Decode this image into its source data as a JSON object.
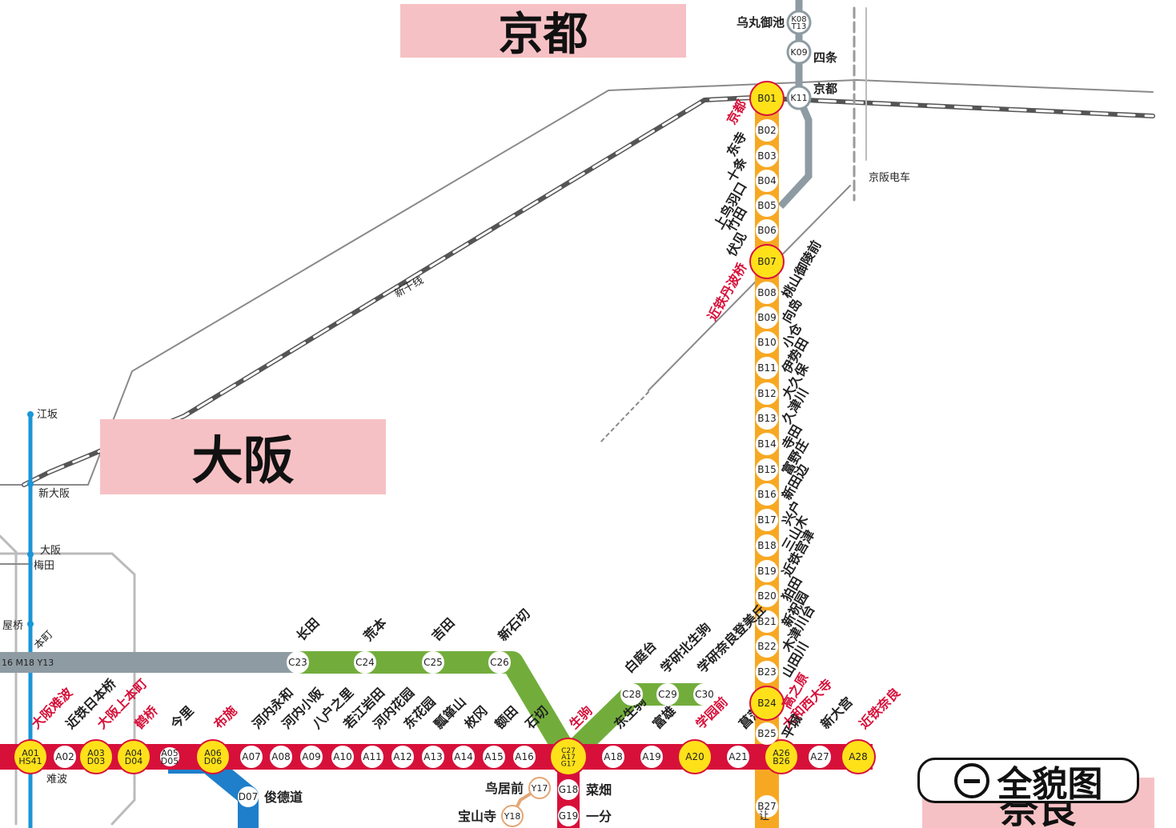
{
  "cities": {
    "kyoto": "京都",
    "osaka": "大阪",
    "nara": "奈良"
  },
  "overview_button": {
    "label": "全貌图",
    "icon": "zoom-out-icon"
  },
  "colors": {
    "line_a": "#d7103a",
    "line_b": "#f7a823",
    "line_c": "#72ad3c",
    "line_k": "#8e9ba3",
    "line_d": "#1f7fca",
    "line_y": "#e3a674",
    "transfer": "#ffe11a",
    "jr": "#555555",
    "region_box": "#f6c1c5"
  },
  "lines": {
    "A": {
      "stations": [
        {
          "code": "A01\nHS41",
          "name": "大阪难波",
          "transfer": true,
          "red": true
        },
        {
          "code": "A02",
          "name": "近铁日本桥"
        },
        {
          "code": "A03\nD03",
          "name": "大阪上本町",
          "transfer": true,
          "red": true
        },
        {
          "code": "A04\nD04",
          "name": "鹤桥",
          "transfer": true,
          "red": true
        },
        {
          "code": "A05\nD05",
          "name": "今里",
          "small": true
        },
        {
          "code": "A06\nD06",
          "name": "布施",
          "transfer": true,
          "red": true
        },
        {
          "code": "A07",
          "name": "河内永和"
        },
        {
          "code": "A08",
          "name": "河内小阪"
        },
        {
          "code": "A09",
          "name": "八户之里"
        },
        {
          "code": "A10",
          "name": "若江岩田"
        },
        {
          "code": "A11",
          "name": "河内花园"
        },
        {
          "code": "A12",
          "name": "东花园"
        },
        {
          "code": "A13",
          "name": "瓢箪山"
        },
        {
          "code": "A14",
          "name": "枚冈"
        },
        {
          "code": "A15",
          "name": "额田"
        },
        {
          "code": "A16",
          "name": "石切"
        },
        {
          "code": "C27\nA17\nG17",
          "name": "生驹",
          "transfer": true,
          "red": true
        },
        {
          "code": "A18",
          "name": "东生驹"
        },
        {
          "code": "A19",
          "name": "富雄"
        },
        {
          "code": "A20",
          "name": "学园前",
          "transfer": true,
          "red": true
        },
        {
          "code": "A21",
          "name": "菖蒲池"
        },
        {
          "code": "A26\nB26",
          "name": "大和西大寺",
          "transfer": true,
          "red": true
        },
        {
          "code": "A27",
          "name": "新大宫"
        },
        {
          "code": "A28",
          "name": "近铁奈良",
          "transfer": true,
          "red": true
        }
      ]
    },
    "B": {
      "stations": [
        {
          "code": "B01",
          "name": "京都",
          "transfer": true,
          "red": true
        },
        {
          "code": "B02",
          "name": "东寺"
        },
        {
          "code": "B03",
          "name": "十条"
        },
        {
          "code": "B04",
          "name": "上鸟羽口"
        },
        {
          "code": "B05",
          "name": "竹田"
        },
        {
          "code": "B06",
          "name": "伏见"
        },
        {
          "code": "B07",
          "name": "近铁丹波桥",
          "transfer": true,
          "red": true
        },
        {
          "code": "B08",
          "name": "桃山御陵前"
        },
        {
          "code": "B09",
          "name": "向岛"
        },
        {
          "code": "B10",
          "name": "小仓"
        },
        {
          "code": "B11",
          "name": "伊势田"
        },
        {
          "code": "B12",
          "name": "大久保"
        },
        {
          "code": "B13",
          "name": "久津川"
        },
        {
          "code": "B14",
          "name": "寺田"
        },
        {
          "code": "B15",
          "name": "富野庄"
        },
        {
          "code": "B16",
          "name": "新田边"
        },
        {
          "code": "B17",
          "name": "兴户"
        },
        {
          "code": "B18",
          "name": "三山木"
        },
        {
          "code": "B19",
          "name": "近铁宫津"
        },
        {
          "code": "B20",
          "name": "狛田"
        },
        {
          "code": "B21",
          "name": "新祝园"
        },
        {
          "code": "B22",
          "name": "木津川台"
        },
        {
          "code": "B23",
          "name": "山田川"
        },
        {
          "code": "B24",
          "name": "高之原",
          "transfer": true,
          "red": true
        },
        {
          "code": "B25",
          "name": "平城"
        },
        {
          "code": "B27",
          "name": ""
        }
      ]
    },
    "C": {
      "stations": [
        {
          "code": "C23",
          "name": "长田"
        },
        {
          "code": "C24",
          "name": "荒本"
        },
        {
          "code": "C25",
          "name": "吉田"
        },
        {
          "code": "C26",
          "name": "新石切"
        }
      ],
      "branch": [
        {
          "code": "C28",
          "name": "白庭台"
        },
        {
          "code": "C29",
          "name": "学研北生驹"
        },
        {
          "code": "C30",
          "name": "学研奈良登美丘"
        }
      ],
      "through_codes": "16 M18 Y13"
    },
    "K": {
      "stations": [
        {
          "code": "K08\nT13",
          "name": "乌丸御池"
        },
        {
          "code": "K09",
          "name": "四条"
        },
        {
          "code": "K11",
          "name": "京都"
        }
      ]
    },
    "G": {
      "stations": [
        {
          "code": "G18",
          "name": "菜畑"
        },
        {
          "code": "G19",
          "name": "一分"
        }
      ]
    },
    "Y": {
      "stations": [
        {
          "code": "Y17",
          "name": "鸟居前"
        },
        {
          "code": "Y18",
          "name": "宝山寺"
        }
      ]
    },
    "D": {
      "stations": [
        {
          "code": "D07",
          "name": "俊德道"
        }
      ]
    }
  },
  "other_labels": {
    "shinkansen": "新干线",
    "keihan": "京阪电车",
    "esaka": "江坂",
    "shin_osaka": "新大阪",
    "osaka_stn": "大阪",
    "umeda": "梅田",
    "yodoyabashi": "屋桥",
    "honmachi": "本町",
    "namba": "难波",
    "b26_extra": "让"
  }
}
